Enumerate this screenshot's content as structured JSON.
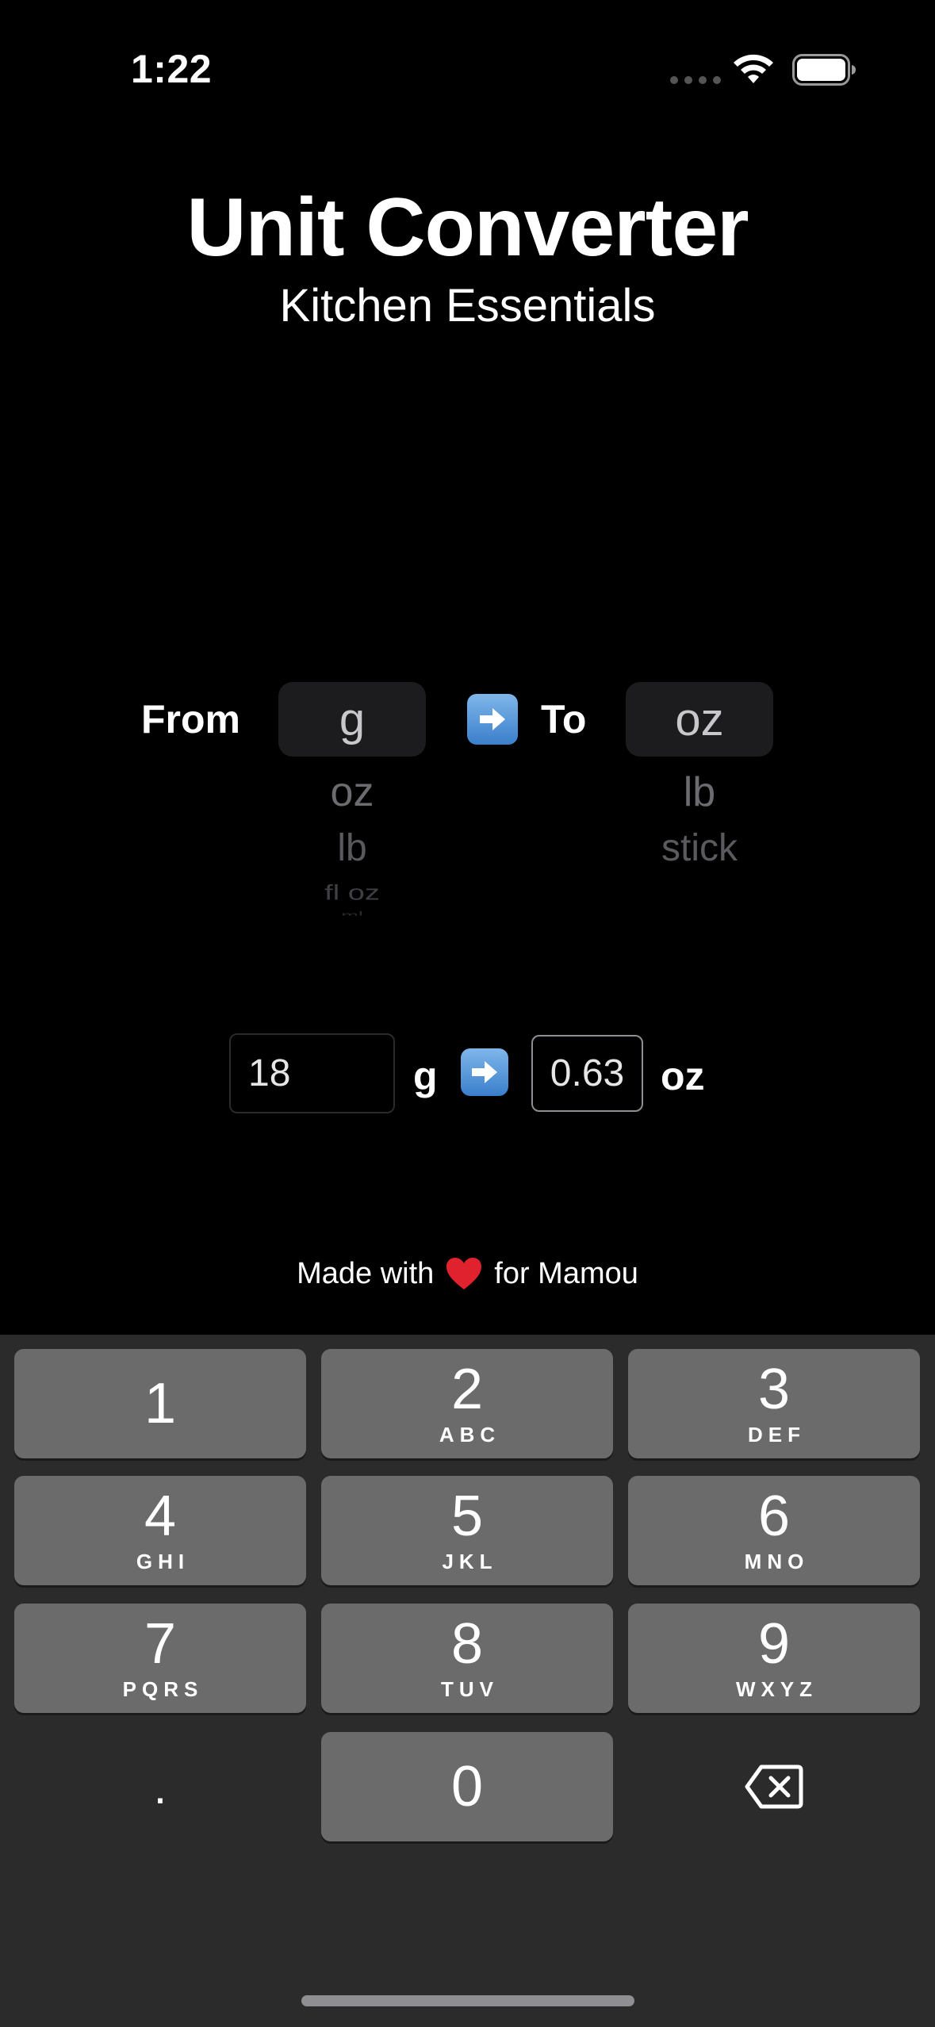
{
  "status_bar": {
    "time": "1:22"
  },
  "header": {
    "title": "Unit Converter",
    "subtitle": "Kitchen Essentials"
  },
  "converter": {
    "from_label": "From",
    "to_label": "To",
    "from_picker": {
      "selected": "g",
      "options": [
        "oz",
        "lb",
        "fl oz",
        "ml"
      ]
    },
    "to_picker": {
      "selected": "oz",
      "options": [
        "lb",
        "stick"
      ]
    },
    "input_value": "18",
    "from_unit": "g",
    "result_value": "0.63",
    "to_unit": "oz"
  },
  "footer": {
    "prefix": "Made with",
    "suffix": "for Mamou"
  },
  "keyboard": {
    "keys": [
      {
        "num": "1",
        "letters": ""
      },
      {
        "num": "2",
        "letters": "ABC"
      },
      {
        "num": "3",
        "letters": "DEF"
      },
      {
        "num": "4",
        "letters": "GHI"
      },
      {
        "num": "5",
        "letters": "JKL"
      },
      {
        "num": "6",
        "letters": "MNO"
      },
      {
        "num": "7",
        "letters": "PQRS"
      },
      {
        "num": "8",
        "letters": "TUV"
      },
      {
        "num": "9",
        "letters": "WXYZ"
      },
      {
        "num": "0",
        "letters": ""
      }
    ],
    "dot": "."
  },
  "icons": {
    "arrow": "right-arrow-emoji",
    "heart": "red-heart-emoji",
    "delete": "backspace-icon",
    "wifi": "wifi-icon",
    "battery": "battery-icon"
  },
  "colors": {
    "background": "#000000",
    "keyboard_bg": "#2b2b2b",
    "key_bg": "#6b6b6b",
    "arrow_blue": "#3a7fcc",
    "heart_red": "#e0212e"
  }
}
